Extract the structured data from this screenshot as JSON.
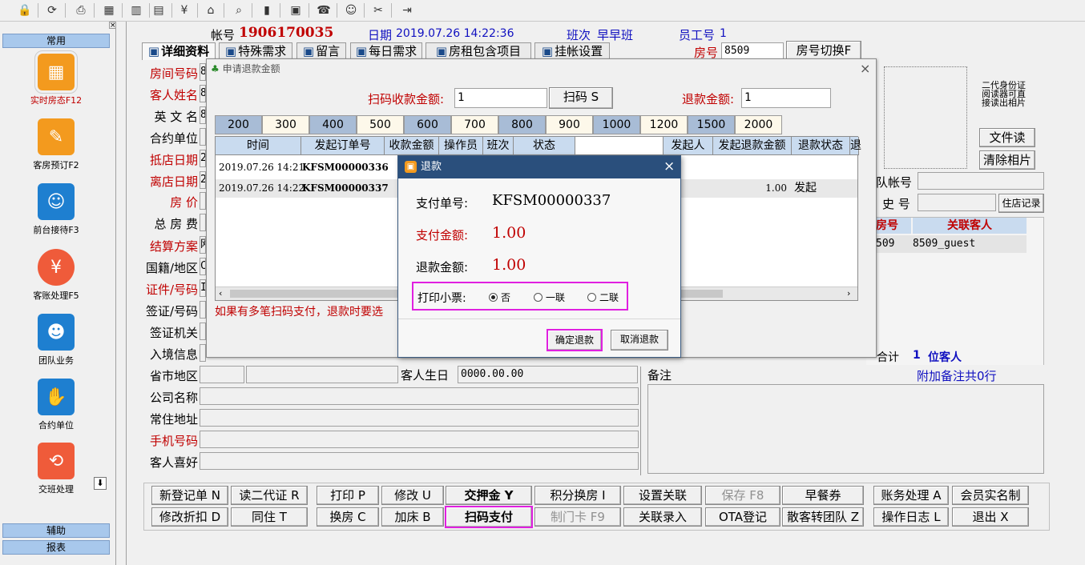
{
  "toolbar": {
    "icons": [
      "lock-icon",
      "refresh-icon",
      "print-icon",
      "calculator-icon",
      "chart-building-icon",
      "chart-building2-icon",
      "money-bag-icon",
      "home-icon",
      "search-document-icon",
      "bar-chart-icon",
      "note-icon",
      "telephone-icon",
      "person-icon",
      "tools-icon",
      "exit-icon"
    ]
  },
  "sidebar": {
    "header_top": "常用",
    "items": [
      {
        "label": "实时房态F12",
        "icon": "room-status-icon",
        "color": "#f39a1e",
        "highlight": true
      },
      {
        "label": "客房预订F2",
        "icon": "booking-icon",
        "color": "#f39a1e"
      },
      {
        "label": "前台接待F3",
        "icon": "reception-icon",
        "color": "#1e7fd0"
      },
      {
        "label": "客账处理F5",
        "icon": "yen-icon",
        "color": "#ef5b3a"
      },
      {
        "label": "团队业务",
        "icon": "group-icon",
        "color": "#1e7fd0"
      },
      {
        "label": "合约单位",
        "icon": "handshake-icon",
        "color": "#1e7fd0"
      },
      {
        "label": "交班处理",
        "icon": "shift-icon",
        "color": "#ef5b3a"
      }
    ],
    "scroll_glyph": "⬇",
    "header_assist": "辅助",
    "header_report": "报表"
  },
  "header": {
    "account_label": "帐号",
    "account": "1906170035",
    "date_label": "日期",
    "date": "2019.07.26 14:22:36",
    "shift_label": "班次",
    "shift": "早早班",
    "staff_label": "员工号",
    "staff": "1",
    "room_label": "房号",
    "room": "8509",
    "switch_room": "房号切换F"
  },
  "tabs": [
    "详细资料",
    "特殊需求",
    "留言",
    "每日需求",
    "房租包含项目",
    "挂帐设置"
  ],
  "left_labels": [
    {
      "text": "房间号码",
      "red": true,
      "value": "8"
    },
    {
      "text": "客人姓名",
      "red": true,
      "value": "8"
    },
    {
      "text": "英 文 名",
      "red": false,
      "value": "8"
    },
    {
      "text": "合约单位",
      "red": false,
      "value": ""
    },
    {
      "text": "抵店日期",
      "red": true,
      "value": "2"
    },
    {
      "text": "离店日期",
      "red": true,
      "value": "2"
    },
    {
      "text": "房    价",
      "red": true,
      "value": ""
    },
    {
      "text": "总 房 费",
      "red": false,
      "value": ""
    },
    {
      "text": "结算方案",
      "red": true,
      "value": "网"
    },
    {
      "text": "国籍/地区",
      "red": false,
      "value": "C"
    },
    {
      "text": "证件/号码",
      "red": true,
      "value": "I"
    },
    {
      "text": "签证/号码",
      "red": false,
      "value": ""
    },
    {
      "text": "签证机关",
      "red": false,
      "value": ""
    },
    {
      "text": "入境信息",
      "red": false,
      "value": ""
    },
    {
      "text": "省市地区",
      "red": false,
      "value": ""
    },
    {
      "text": "公司名称",
      "red": false,
      "value": ""
    },
    {
      "text": "常住地址",
      "red": false,
      "value": ""
    },
    {
      "text": "手机号码",
      "red": true,
      "value": ""
    },
    {
      "text": "客人喜好",
      "red": false,
      "value": ""
    }
  ],
  "birthday": {
    "label": "客人生日",
    "value": "0000.00.00"
  },
  "right_panel": {
    "id_reader": [
      "二代身份证",
      "阅读器可直",
      "接读出相片"
    ],
    "file_read": "文件读",
    "clear_photo": "清除相片",
    "team_account": "队帐号",
    "history": "史 号",
    "store_record": "住店记录",
    "col_room": "房号",
    "col_guest": "关联客人",
    "row_room": "509",
    "row_guest": "8509_guest",
    "total_label": "合计",
    "total_count": "1",
    "total_unit": "位客人",
    "remark_label": "备注",
    "remark_extra": "附加备注共0行"
  },
  "buttons_row1": [
    "新登记单 N",
    "读二代证 R",
    "打印 P",
    "修改 U",
    "交押金 Y",
    "积分换房 I",
    "设置关联",
    "保存 F8",
    "早餐券",
    "账务处理 A",
    "会员实名制"
  ],
  "buttons_row2": [
    "修改折扣 D",
    "同住 T",
    "换房 C",
    "加床 B",
    "扫码支付",
    "制门卡 F9",
    "关联录入",
    "OTA登记",
    "散客转团队 Z",
    "操作日志 L",
    "退出 X"
  ],
  "refund_request": {
    "title": "申请退款金额",
    "scan_amount_label": "扫码收款金额:",
    "scan_amount": "1",
    "scan_button": "扫码 S",
    "refund_amount_label": "退款金额:",
    "refund_amount": "1",
    "amounts": [
      "200",
      "300",
      "400",
      "500",
      "600",
      "700",
      "800",
      "900",
      "1000",
      "1200",
      "1500",
      "2000"
    ],
    "columns": [
      "时间",
      "发起订单号",
      "收款金额",
      "操作员",
      "班次",
      "状态",
      "",
      "发起人",
      "发起退款金额",
      "退款状态",
      "退"
    ],
    "rows": [
      {
        "time": "2019.07.26 14:21",
        "order": "KFSM00000336",
        "refund": "",
        "refund_status": ""
      },
      {
        "time": "2019.07.26 14:22",
        "order": "KFSM00000337",
        "refund": "1.00",
        "refund_status": "发起"
      }
    ],
    "note": "如果有多笔扫码支付，退款时要选"
  },
  "refund_dialog": {
    "title": "退款",
    "pay_no_label": "支付单号:",
    "pay_no": "KFSM00000337",
    "pay_amount_label": "支付金额:",
    "pay_amount": "1.00",
    "refund_amount_label": "退款金额:",
    "refund_amount": "1.00",
    "print_label": "打印小票:",
    "options": [
      "否",
      "一联",
      "二联"
    ],
    "selected": "否",
    "confirm": "确定退款",
    "cancel": "取消退款"
  }
}
